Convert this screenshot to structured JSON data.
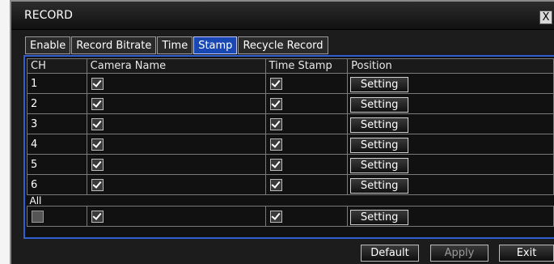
{
  "window": {
    "title": "RECORD",
    "close_label": "X"
  },
  "tabs": [
    {
      "label": "Enable",
      "active": false
    },
    {
      "label": "Record Bitrate",
      "active": false
    },
    {
      "label": "Time",
      "active": false
    },
    {
      "label": "Stamp",
      "active": true
    },
    {
      "label": "Recycle Record",
      "active": false
    }
  ],
  "table": {
    "headers": {
      "ch": "CH",
      "camera_name": "Camera Name",
      "time_stamp": "Time Stamp",
      "position": "Position"
    },
    "rows": [
      {
        "ch": "1",
        "camera_name": true,
        "time_stamp": true,
        "position_label": "Setting"
      },
      {
        "ch": "2",
        "camera_name": true,
        "time_stamp": true,
        "position_label": "Setting"
      },
      {
        "ch": "3",
        "camera_name": true,
        "time_stamp": true,
        "position_label": "Setting"
      },
      {
        "ch": "4",
        "camera_name": true,
        "time_stamp": true,
        "position_label": "Setting"
      },
      {
        "ch": "5",
        "camera_name": true,
        "time_stamp": true,
        "position_label": "Setting"
      },
      {
        "ch": "6",
        "camera_name": true,
        "time_stamp": true,
        "position_label": "Setting"
      }
    ],
    "all": {
      "label": "All",
      "select": false,
      "camera_name": true,
      "time_stamp": true,
      "position_label": "Setting"
    }
  },
  "footer": {
    "default_label": "Default",
    "apply_label": "Apply",
    "exit_label": "Exit"
  },
  "colors": {
    "accent": "#2f5fd0",
    "active_tab": "#1947b4",
    "background": "#1c1c1c"
  }
}
